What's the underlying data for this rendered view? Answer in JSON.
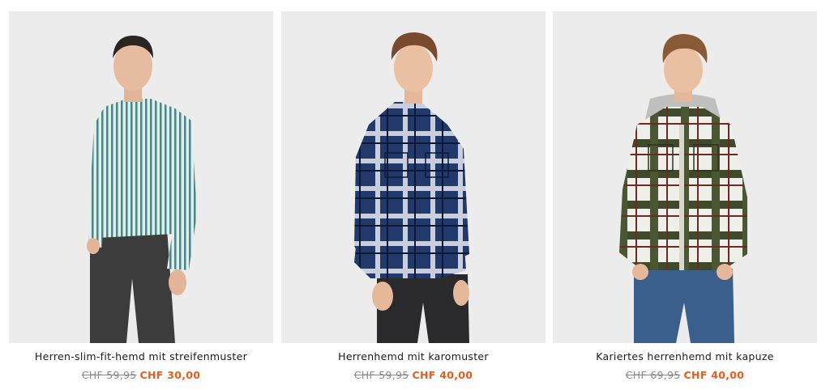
{
  "products": [
    {
      "name": "Herren-slim-fit-hemd mit streifenmuster",
      "old_price": "CHF 59,95",
      "new_price": "CHF 30,00"
    },
    {
      "name": "Herrenhemd mit karomuster",
      "old_price": "CHF 59,95",
      "new_price": "CHF 40,00"
    },
    {
      "name": "Kariertes herrenhemd mit kapuze",
      "old_price": "CHF 69,95",
      "new_price": "CHF 40,00"
    }
  ],
  "colors": {
    "sale": "#f25a18",
    "strikethrough": "#8a8a8a",
    "photo_bg": "#ececec"
  }
}
